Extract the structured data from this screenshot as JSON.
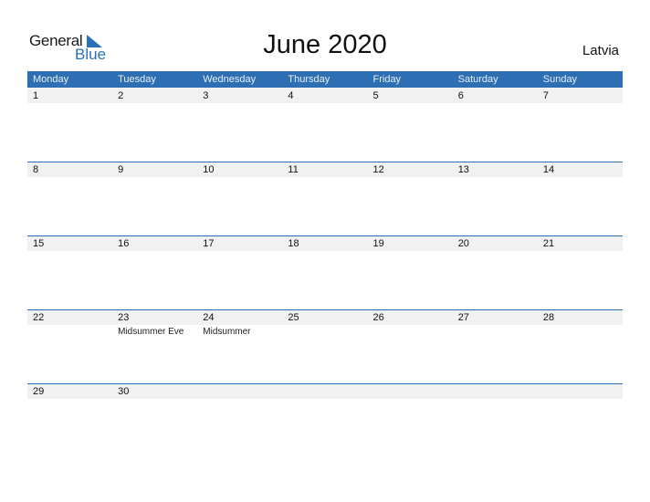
{
  "logo": {
    "general": "General",
    "blue": "Blue"
  },
  "title": "June 2020",
  "country": "Latvia",
  "colors": {
    "header": "#2e6fb3",
    "band": "#f1f1f1"
  },
  "weekdays": [
    "Monday",
    "Tuesday",
    "Wednesday",
    "Thursday",
    "Friday",
    "Saturday",
    "Sunday"
  ],
  "weeks": [
    [
      {
        "day": "1"
      },
      {
        "day": "2"
      },
      {
        "day": "3"
      },
      {
        "day": "4"
      },
      {
        "day": "5"
      },
      {
        "day": "6"
      },
      {
        "day": "7"
      }
    ],
    [
      {
        "day": "8"
      },
      {
        "day": "9"
      },
      {
        "day": "10"
      },
      {
        "day": "11"
      },
      {
        "day": "12"
      },
      {
        "day": "13"
      },
      {
        "day": "14"
      }
    ],
    [
      {
        "day": "15"
      },
      {
        "day": "16"
      },
      {
        "day": "17"
      },
      {
        "day": "18"
      },
      {
        "day": "19"
      },
      {
        "day": "20"
      },
      {
        "day": "21"
      }
    ],
    [
      {
        "day": "22"
      },
      {
        "day": "23",
        "event": "Midsummer Eve"
      },
      {
        "day": "24",
        "event": "Midsummer"
      },
      {
        "day": "25"
      },
      {
        "day": "26"
      },
      {
        "day": "27"
      },
      {
        "day": "28"
      }
    ],
    [
      {
        "day": "29"
      },
      {
        "day": "30"
      },
      {
        "day": ""
      },
      {
        "day": ""
      },
      {
        "day": ""
      },
      {
        "day": ""
      },
      {
        "day": ""
      }
    ]
  ]
}
